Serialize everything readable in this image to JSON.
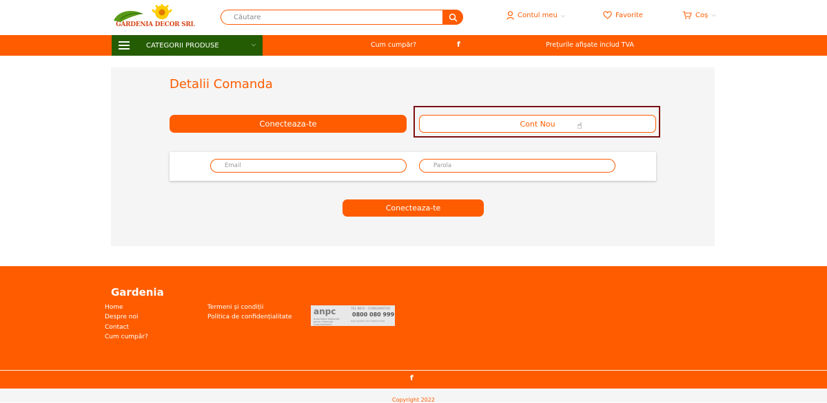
{
  "header": {
    "logo_text": "GARDENIA DECOR SRL",
    "search_placeholder": "Căutare",
    "account_label": "Contul meu",
    "favorites_label": "Favorite",
    "cart_label": "Coș"
  },
  "nav": {
    "categories_label": "CATEGORII PRODUSE",
    "how_to_buy": "Cum cumpăr?",
    "vat_notice": "Prețurile afișate includ TVA",
    "facebook_glyph": "f"
  },
  "main": {
    "title": "Detalii Comanda",
    "login_tab": "Conecteaza-te",
    "new_account_tab": "Cont Nou",
    "email_placeholder": "Email",
    "password_placeholder": "Parola",
    "submit_label": "Conecteaza-te"
  },
  "footer": {
    "title": "Gardenia",
    "col1": [
      "Home",
      "Despre noi",
      "Contact",
      "Cum cumpăr?"
    ],
    "col2": [
      "Termeni și condiții",
      "Politica de confidențialitate"
    ],
    "anpc": {
      "logo": "anpc",
      "subtitle": "Autoritatea Națională pentru Protecția Consumatorilor",
      "tel_label": "TEL INFO - CONSUMATOR",
      "number": "0800 080 999",
      "small": "Apel gratuit din rețeaua fixă"
    },
    "facebook_glyph": "f",
    "copyright": "Copyright 2022"
  },
  "colors": {
    "accent": "#ff5c00",
    "category_bg": "#245c04",
    "highlight_border": "#7b1012",
    "panel_bg": "#f5f5f5"
  },
  "icons": {
    "search": "search-icon",
    "user": "user-icon",
    "heart": "heart-icon",
    "cart": "cart-icon",
    "menu": "hamburger-icon",
    "facebook": "facebook-icon",
    "cursor": "hand-cursor-icon"
  }
}
